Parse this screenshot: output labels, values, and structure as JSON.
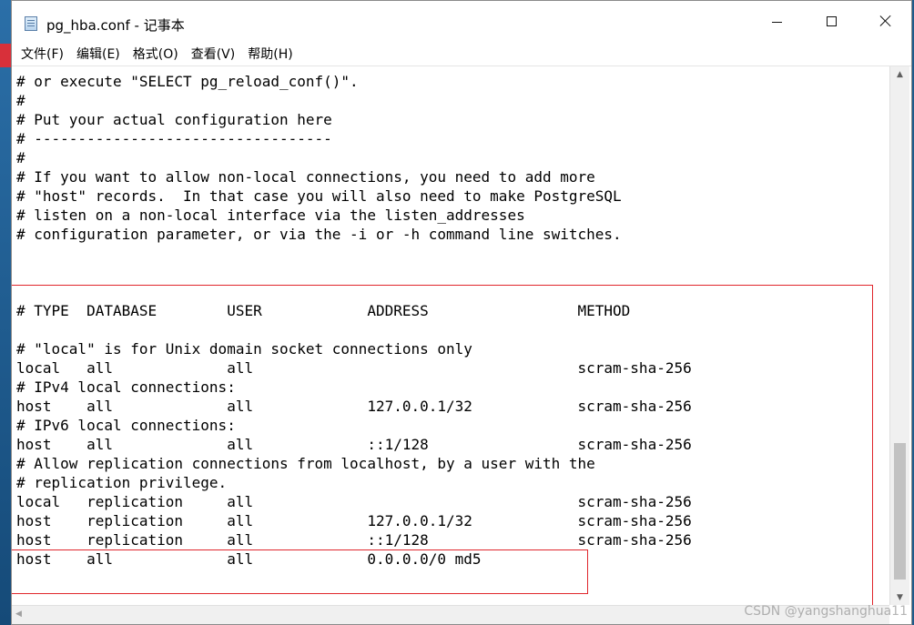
{
  "window": {
    "title": "pg_hba.conf - 记事本",
    "controls": {
      "minimize": "—",
      "maximize": "☐",
      "close": "✕"
    }
  },
  "menu": [
    {
      "label": "文件(F)"
    },
    {
      "label": "编辑(E)"
    },
    {
      "label": "格式(O)"
    },
    {
      "label": "查看(V)"
    },
    {
      "label": "帮助(H)"
    }
  ],
  "editor": {
    "lines": [
      "# or execute \"SELECT pg_reload_conf()\".",
      "#",
      "# Put your actual configuration here",
      "# ----------------------------------",
      "#",
      "# If you want to allow non-local connections, you need to add more",
      "# \"host\" records.  In that case you will also need to make PostgreSQL",
      "# listen on a non-local interface via the listen_addresses",
      "# configuration parameter, or via the -i or -h command line switches.",
      "",
      "",
      "",
      "# TYPE  DATABASE        USER            ADDRESS                 METHOD",
      "",
      "# \"local\" is for Unix domain socket connections only",
      "local   all             all                                     scram-sha-256",
      "# IPv4 local connections:",
      "host    all             all             127.0.0.1/32            scram-sha-256",
      "# IPv6 local connections:",
      "host    all             all             ::1/128                 scram-sha-256",
      "# Allow replication connections from localhost, by a user with the",
      "# replication privilege.",
      "local   replication     all                                     scram-sha-256",
      "host    replication     all             127.0.0.1/32            scram-sha-256",
      "host    replication     all             ::1/128                 scram-sha-256",
      "host    all             all             0.0.0.0/0 md5"
    ]
  },
  "scrollbars": {
    "up_arrow": "▲",
    "down_arrow": "▼",
    "left_arrow": "◀"
  },
  "watermark": "CSDN @yangshanghua11"
}
